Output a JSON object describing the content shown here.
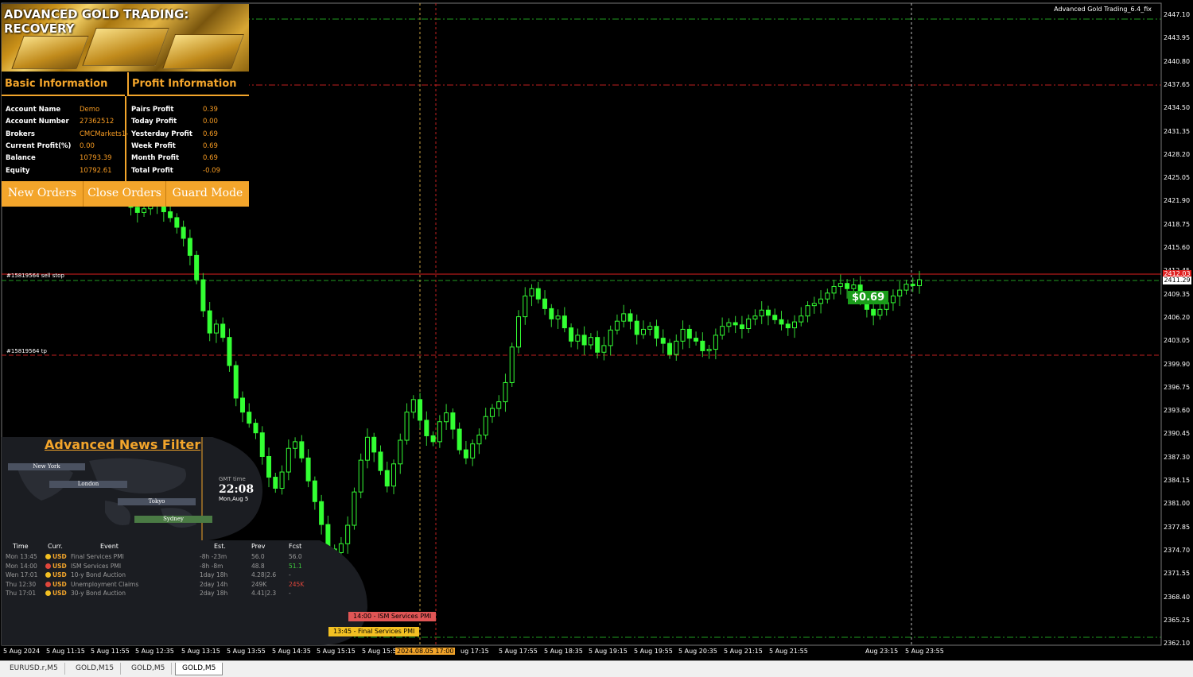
{
  "ea_label": "Advanced Gold Trading_6.4_fix",
  "gold_panel": {
    "title": "ADVANCED GOLD TRADING: RECOVERY",
    "basic_header": "Basic Information",
    "profit_header": "Profit Information",
    "basic": [
      {
        "key": "Account Name",
        "value": "Demo"
      },
      {
        "key": "Account Number",
        "value": "27362512"
      },
      {
        "key": "Brokers",
        "value": "CMCMarkets1-"
      },
      {
        "key": "Current Profit(%)",
        "value": "0.00"
      },
      {
        "key": "Balance",
        "value": "10793.39"
      },
      {
        "key": "Equity",
        "value": "10792.61"
      }
    ],
    "profit": [
      {
        "key": "Pairs Profit",
        "value": "0.39"
      },
      {
        "key": "Today Profit",
        "value": "0.00"
      },
      {
        "key": "Yesterday Profit",
        "value": "0.69"
      },
      {
        "key": "Week Profit",
        "value": "0.69"
      },
      {
        "key": "Month Profit",
        "value": "0.69"
      },
      {
        "key": "Total Profit",
        "value": "-0.09"
      }
    ],
    "buttons": [
      "New Orders",
      "Close Orders",
      "Guard Mode"
    ],
    "accent_color": "#f3a52b"
  },
  "news_panel": {
    "title": "Advanced News Filter",
    "sessions": [
      "New York",
      "London",
      "Tokyo",
      "Sydney"
    ],
    "gmt_label": "GMT time",
    "gmt_time": "22:08",
    "gmt_date": "Mon,Aug 5",
    "headers": [
      "Time",
      "Curr.",
      "Event",
      "Est.",
      "Prev",
      "Fcst"
    ],
    "rows": [
      {
        "time": "Mon 13:45",
        "dot": "#f3c022",
        "curr": "USD",
        "event": "Final Services PMI",
        "est": "-8h -23m",
        "prev": "56.0",
        "fcst": "56.0",
        "fcst_color": "#999"
      },
      {
        "time": "Mon 14:00",
        "dot": "#e0463b",
        "curr": "USD",
        "event": "ISM Services PMI",
        "est": "-8h -8m",
        "prev": "48.8",
        "fcst": "51.1",
        "fcst_color": "#3fcf3f"
      },
      {
        "time": "Wen 17:01",
        "dot": "#f3c022",
        "curr": "USD",
        "event": "10-y Bond Auction",
        "est": "1day 18h",
        "prev": "4.28|2.6",
        "fcst": "-",
        "fcst_color": "#999"
      },
      {
        "time": "Thu 12:30",
        "dot": "#e0463b",
        "curr": "USD",
        "event": "Unemployment Claims",
        "est": "2day 14h",
        "prev": "249K",
        "fcst": "245K",
        "fcst_color": "#e0463b"
      },
      {
        "time": "Thu 17:01",
        "dot": "#f3c022",
        "curr": "USD",
        "event": "30-y Bond Auction",
        "est": "2day 18h",
        "prev": "4.41|2.3",
        "fcst": "-",
        "fcst_color": "#999"
      }
    ],
    "event_tags": [
      {
        "text": "14:00 - ISM Services PMI",
        "color": "#e05555"
      },
      {
        "text": "13:45 - Final Services PMI",
        "color": "#f3c022"
      }
    ]
  },
  "order_labels": [
    "#15819564 sell stop",
    "#15819564 tp"
  ],
  "profit_tag": "$0.69",
  "price_axis": [
    "2447.10",
    "2443.95",
    "2440.80",
    "2437.65",
    "2434.50",
    "2431.35",
    "2428.20",
    "2425.05",
    "2421.90",
    "2418.75",
    "2415.60",
    "2412.45",
    "2409.35",
    "2406.20",
    "2403.05",
    "2399.90",
    "2396.75",
    "2393.60",
    "2390.45",
    "2387.30",
    "2384.15",
    "2381.00",
    "2377.85",
    "2374.70",
    "2371.55",
    "2368.40",
    "2365.25",
    "2362.10"
  ],
  "current_price": "2411.29",
  "red_price": "2412.03",
  "time_axis": [
    "5 Aug 2024",
    "5 Aug 11:15",
    "5 Aug 11:55",
    "5 Aug 12:35",
    "5 Aug 13:15",
    "5 Aug 13:55",
    "5 Aug 14:35",
    "5 Aug 15:15",
    "5 Aug 15:5",
    "2024.08.05 17:00",
    "ug 17:15",
    "5 Aug 17:55",
    "5 Aug 18:35",
    "5 Aug 19:15",
    "5 Aug 19:55",
    "5 Aug 20:35",
    "5 Aug 21:15",
    "5 Aug 21:55",
    "Aug 23:15",
    "5 Aug 23:55"
  ],
  "tabs": [
    "EURUSD.r,M5",
    "GOLD,M15",
    "GOLD,M5",
    "GOLD,M5"
  ],
  "chart_data": {
    "type": "candlestick",
    "symbol": "GOLD",
    "timeframe": "M5",
    "y_range": [
      2362.1,
      2447.1
    ],
    "closes": [
      2422.5,
      2422.0,
      2421.0,
      2420.3,
      2420.8,
      2421.5,
      2421.2,
      2420.4,
      2419.6,
      2418.3,
      2416.8,
      2414.5,
      2411.2,
      2407.0,
      2404.0,
      2405.2,
      2403.4,
      2399.6,
      2395.2,
      2393.3,
      2391.8,
      2390.5,
      2387.3,
      2384.5,
      2383.0,
      2385.2,
      2388.4,
      2389.3,
      2387.1,
      2384.0,
      2381.2,
      2378.1,
      2374.8,
      2374.3,
      2375.5,
      2378.0,
      2382.5,
      2386.8,
      2389.9,
      2387.9,
      2385.4,
      2383.3,
      2386.3,
      2389.5,
      2393.3,
      2395.0,
      2392.2,
      2390.1,
      2389.3,
      2392.0,
      2393.2,
      2391.0,
      2388.2,
      2387.1,
      2389.0,
      2390.2,
      2392.7,
      2393.8,
      2394.7,
      2397.3,
      2402.1,
      2406.2,
      2409.0,
      2410.0,
      2408.6,
      2407.3,
      2405.9,
      2406.3,
      2404.7,
      2402.9,
      2403.7,
      2402.4,
      2403.4,
      2401.4,
      2402.3,
      2404.4,
      2405.6,
      2406.6,
      2405.6,
      2403.8,
      2404.5,
      2404.9,
      2403.3,
      2402.6,
      2401.1,
      2402.9,
      2404.5,
      2403.3,
      2402.9,
      2401.6,
      2401.8,
      2403.7,
      2404.9,
      2405.4,
      2405.1,
      2404.6,
      2405.9,
      2406.3,
      2407.1,
      2406.4,
      2405.8,
      2405.2,
      2404.7,
      2405.5,
      2406.3,
      2407.7,
      2408.0,
      2408.6,
      2409.4,
      2410.3,
      2410.7,
      2410.0,
      2410.5,
      2408.6,
      2407.2,
      2406.4,
      2407.2,
      2408.1,
      2409.0,
      2409.8,
      2410.6,
      2410.4,
      2411.2
    ]
  }
}
